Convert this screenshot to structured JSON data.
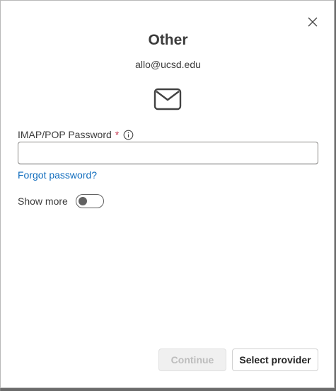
{
  "dialog": {
    "title": "Other",
    "email": "allo@ucsd.edu",
    "password_label": "IMAP/POP Password",
    "required_marker": "*",
    "password_value": "",
    "forgot_link": "Forgot password?",
    "show_more_label": "Show more",
    "show_more_on": false,
    "continue_label": "Continue",
    "continue_enabled": false,
    "select_provider_label": "Select provider"
  },
  "icons": {
    "close": "close-icon",
    "mail": "mail-icon",
    "info": "info-icon"
  },
  "colors": {
    "link": "#0f6cbd",
    "required": "#c4314b",
    "text": "#3b3b3b"
  }
}
